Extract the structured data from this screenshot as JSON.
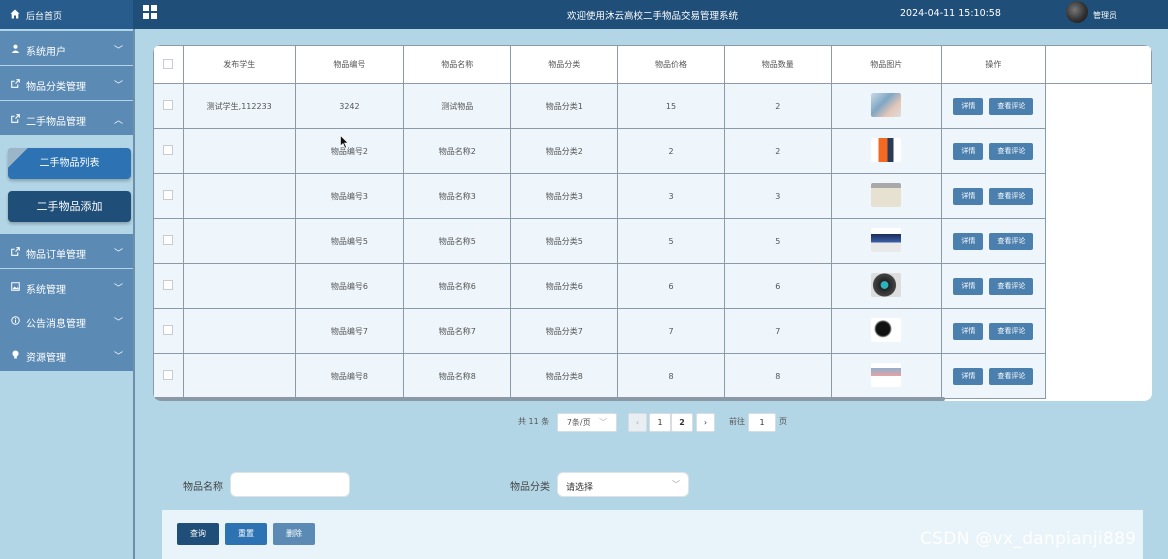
{
  "header": {
    "home_label": "后台首页",
    "welcome": "欢迎使用沐云高校二手物品交易管理系统",
    "datetime": "2024-04-11 15:10:58",
    "user": "管理员"
  },
  "sidebar": {
    "items": [
      {
        "label": "系统用户",
        "icon": "user-icon",
        "chevron": "﹀"
      },
      {
        "label": "物品分类管理",
        "icon": "external-icon",
        "chevron": "﹀"
      },
      {
        "label": "二手物品管理",
        "icon": "external-icon",
        "chevron": "︿"
      },
      {
        "label": "物品订单管理",
        "icon": "external-icon",
        "chevron": "﹀"
      },
      {
        "label": "系统管理",
        "icon": "image-icon",
        "chevron": "﹀"
      },
      {
        "label": "公告消息管理",
        "icon": "info-icon",
        "chevron": "﹀"
      },
      {
        "label": "资源管理",
        "icon": "bulb-icon",
        "chevron": "﹀"
      }
    ],
    "sub_items": [
      {
        "label": "二手物品列表",
        "active": true
      },
      {
        "label": "二手物品添加",
        "active": false
      }
    ]
  },
  "table": {
    "columns": [
      "发布学生",
      "物品编号",
      "物品名称",
      "物品分类",
      "物品价格",
      "物品数量",
      "物品图片",
      "操作"
    ],
    "rows": [
      {
        "student": "测试学生,112233",
        "code": "3242",
        "name": "测试物品",
        "category": "物品分类1",
        "price": "15",
        "qty": "2",
        "thumb": "phone-case-image"
      },
      {
        "student": "",
        "code": "物品编号2",
        "name": "物品名称2",
        "category": "物品分类2",
        "price": "2",
        "qty": "2",
        "thumb": "orange-phone-image"
      },
      {
        "student": "",
        "code": "物品编号3",
        "name": "物品名称3",
        "category": "物品分类3",
        "price": "3",
        "qty": "3",
        "thumb": "tote-bag-image"
      },
      {
        "student": "",
        "code": "物品编号5",
        "name": "物品名称5",
        "category": "物品分类5",
        "price": "5",
        "qty": "5",
        "thumb": "monitor-image"
      },
      {
        "student": "",
        "code": "物品编号6",
        "name": "物品名称6",
        "category": "物品分类6",
        "price": "6",
        "qty": "6",
        "thumb": "speaker-image"
      },
      {
        "student": "",
        "code": "物品编号7",
        "name": "物品名称7",
        "category": "物品分类7",
        "price": "7",
        "qty": "7",
        "thumb": "camera-image"
      },
      {
        "student": "",
        "code": "物品编号8",
        "name": "物品名称8",
        "category": "物品分类8",
        "price": "8",
        "qty": "8",
        "thumb": "drying-rack-image"
      }
    ],
    "detail_label": "详情",
    "review_label": "查看评论"
  },
  "pagination": {
    "total": "共 11 条",
    "page_size": "7条/页",
    "pages": [
      "1",
      "2"
    ],
    "prev": "‹",
    "next": "›",
    "goto_prefix": "前往",
    "goto_value": "1",
    "goto_suffix": "页"
  },
  "search": {
    "name_label": "物品名称",
    "name_value": "",
    "category_label": "物品分类",
    "category_value": "请选择"
  },
  "actions": {
    "query": "查询",
    "reset": "重置",
    "delete": "删除"
  },
  "watermark": "CSDN @vx_danpianji889",
  "colors": {
    "topbar": "#1f4e79",
    "sidebar_item": "#5b8ab4",
    "button": "#4b7fae",
    "background": "#b3d6e6"
  }
}
